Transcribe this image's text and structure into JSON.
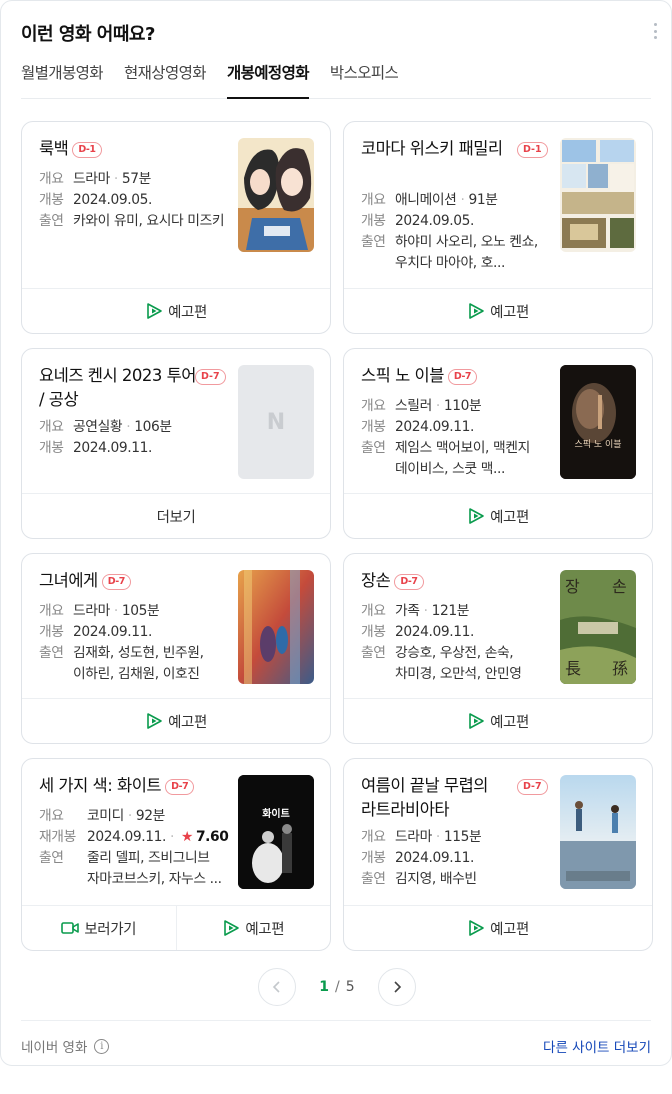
{
  "header": {
    "title": "이런 영화 어때요?",
    "more_icon": "more-vertical-icon"
  },
  "tabs": [
    {
      "label": "월별개봉영화",
      "active": false
    },
    {
      "label": "현재상영영화",
      "active": false
    },
    {
      "label": "개봉예정영화",
      "active": true
    },
    {
      "label": "박스오피스",
      "active": false
    }
  ],
  "movies": [
    {
      "title": "룩백",
      "badge": "D-1",
      "genre_key": "개요",
      "genre": "드라마",
      "runtime": "57분",
      "release_key": "개봉",
      "release": "2024.09.05.",
      "cast_key": "출연",
      "cast": "카와이 유미, 요시다 미즈키",
      "footer": [
        "예고편"
      ],
      "poster": "anime-poster"
    },
    {
      "title": "코마다 위스키 패밀리",
      "badge": "D-1",
      "genre_key": "개요",
      "genre": "애니메이션",
      "runtime": "91분",
      "release_key": "개봉",
      "release": "2024.09.05.",
      "cast_key": "출연",
      "cast": "하야미 사오리, 오노 켄쇼, 우치다 마아야, 호...",
      "footer": [
        "예고편"
      ],
      "poster": "anime-collage-poster"
    },
    {
      "title": "요네즈 켄시 2023 투어 / 공상",
      "badge": "D-7",
      "genre_key": "개요",
      "genre": "공연실황",
      "runtime": "106분",
      "release_key": "개봉",
      "release": "2024.09.11.",
      "footer": [
        "더보기"
      ],
      "poster": "placeholder-poster",
      "placeholder_letter": "N"
    },
    {
      "title": "스픽 노 이블",
      "badge": "D-7",
      "genre_key": "개요",
      "genre": "스릴러",
      "runtime": "110분",
      "release_key": "개봉",
      "release": "2024.09.11.",
      "cast_key": "출연",
      "cast": "제임스 맥어보이, 맥켄지 데이비스, 스쿳 맥...",
      "footer": [
        "예고편"
      ],
      "poster": "dark-portrait-poster",
      "poster_text": "스픽 노 이블"
    },
    {
      "title": "그녀에게",
      "badge": "D-7",
      "genre_key": "개요",
      "genre": "드라마",
      "runtime": "105분",
      "release_key": "개봉",
      "release": "2024.09.11.",
      "cast_key": "출연",
      "cast": "김재화, 성도현, 빈주원, 이하린, 김채원, 이호진",
      "footer": [
        "예고편"
      ],
      "poster": "blurred-colorful-poster"
    },
    {
      "title": "장손",
      "badge": "D-7",
      "genre_key": "개요",
      "genre": "가족",
      "runtime": "121분",
      "release_key": "개봉",
      "release": "2024.09.11.",
      "cast_key": "출연",
      "cast": "강승호, 우상전, 손숙, 차미경, 오만석, 안민영",
      "footer": [
        "예고편"
      ],
      "poster": "green-family-poster"
    },
    {
      "title": "세 가지 색: 화이트",
      "badge": "D-7",
      "genre_key": "개요",
      "genre": "코미디",
      "runtime": "92분",
      "release_key": "재개봉",
      "release": "2024.09.11.",
      "rating": "7.60",
      "cast_key": "출연",
      "cast": "줄리 델피, 즈비그니브 자마코브스키, 자누스 ...",
      "footer": [
        "보러가기",
        "예고편"
      ],
      "poster": "bw-wedding-poster",
      "poster_text": "화이트"
    },
    {
      "title": "여름이 끝날 무렵의 라트라비아타",
      "badge": "D-7",
      "genre_key": "개요",
      "genre": "드라마",
      "runtime": "115분",
      "release_key": "개봉",
      "release": "2024.09.11.",
      "cast_key": "출연",
      "cast": "김지영, 배수빈",
      "footer": [
        "예고편"
      ],
      "poster": "seaside-poster"
    }
  ],
  "pagination": {
    "current": "1",
    "separator": "/",
    "total": "5"
  },
  "footer": {
    "source": "네이버 영화",
    "more_sites": "다른 사이트 더보기"
  },
  "colors": {
    "accent_green": "#0a9b4d",
    "badge_red": "#e8424a",
    "link_blue": "#1447b8"
  }
}
